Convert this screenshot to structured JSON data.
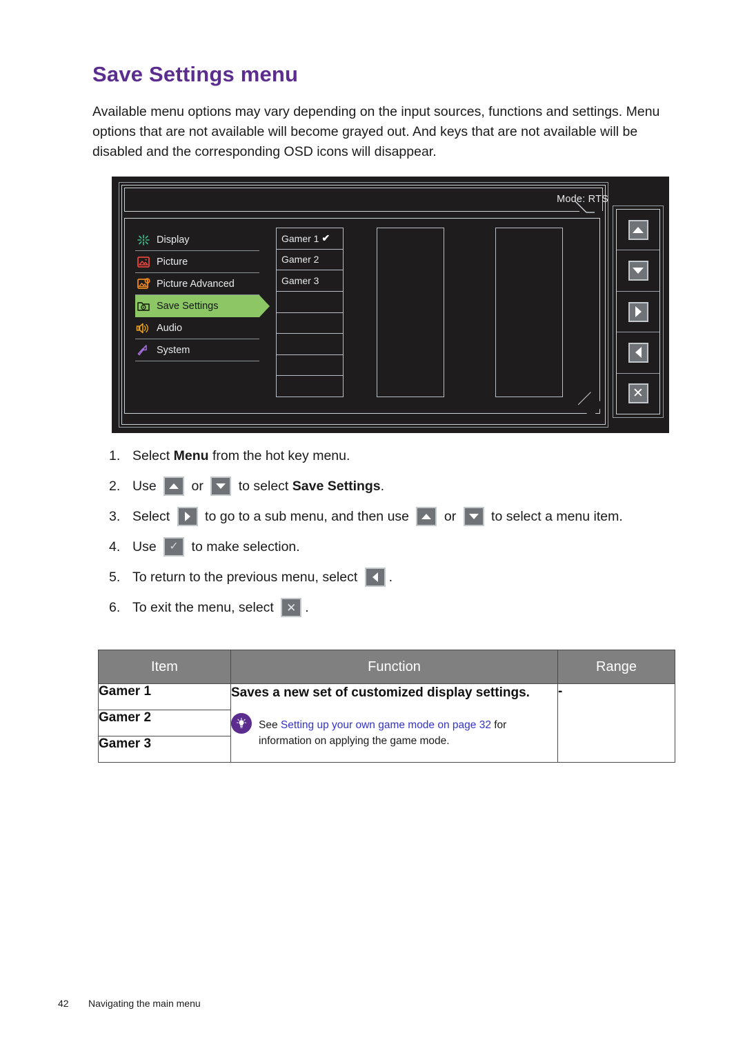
{
  "page": {
    "title": "Save Settings menu",
    "title_color": "#5b2d8e",
    "intro": "Available menu options may vary depending on the input sources, functions and settings. Menu options that are not available will become grayed out. And keys that are not available will be disabled and the corresponding OSD icons will disappear."
  },
  "osd": {
    "mode_label": "Mode: RTS",
    "menu_items": [
      {
        "label": "Display",
        "icon": "display-icon",
        "icon_color": "#3fbf8f",
        "selected": false
      },
      {
        "label": "Picture",
        "icon": "picture-icon",
        "icon_color": "#e8443c",
        "selected": false
      },
      {
        "label": "Picture Advanced",
        "icon": "picture-advanced-icon",
        "icon_color": "#f08a20",
        "selected": false
      },
      {
        "label": "Save Settings",
        "icon": "save-settings-icon",
        "icon_color": "#1d2b12",
        "selected": true
      },
      {
        "label": "Audio",
        "icon": "audio-icon",
        "icon_color": "#e8a01c",
        "selected": false
      },
      {
        "label": "System",
        "icon": "system-icon",
        "icon_color": "#a06fd8",
        "selected": false
      }
    ],
    "highlight_color": "#8cc665",
    "options": [
      {
        "label": "Gamer 1",
        "checked": true,
        "check_glyph": "✔"
      },
      {
        "label": "Gamer 2",
        "checked": false,
        "check_glyph": ""
      },
      {
        "label": "Gamer 3",
        "checked": false,
        "check_glyph": ""
      },
      {
        "label": "",
        "checked": false,
        "check_glyph": ""
      },
      {
        "label": "",
        "checked": false,
        "check_glyph": ""
      },
      {
        "label": "",
        "checked": false,
        "check_glyph": ""
      },
      {
        "label": "",
        "checked": false,
        "check_glyph": ""
      },
      {
        "label": "",
        "checked": false,
        "check_glyph": ""
      }
    ],
    "keys": [
      {
        "name": "up-key",
        "glyph": "▲"
      },
      {
        "name": "down-key",
        "glyph": "▼"
      },
      {
        "name": "right-key",
        "glyph": "▶"
      },
      {
        "name": "left-key",
        "glyph": "◀"
      },
      {
        "name": "exit-key",
        "glyph": "✕"
      }
    ]
  },
  "steps": [
    {
      "num": "1.",
      "parts": [
        {
          "t": "text",
          "v": "Select "
        },
        {
          "t": "bold",
          "v": "Menu"
        },
        {
          "t": "text",
          "v": " from the hot key menu."
        }
      ]
    },
    {
      "num": "2.",
      "parts": [
        {
          "t": "text",
          "v": "Use "
        },
        {
          "t": "key",
          "v": "up"
        },
        {
          "t": "text",
          "v": " or "
        },
        {
          "t": "key",
          "v": "down"
        },
        {
          "t": "text",
          "v": " to select "
        },
        {
          "t": "bold",
          "v": "Save Settings"
        },
        {
          "t": "text",
          "v": "."
        }
      ]
    },
    {
      "num": "3.",
      "parts": [
        {
          "t": "text",
          "v": "Select "
        },
        {
          "t": "key",
          "v": "right"
        },
        {
          "t": "text",
          "v": " to go to a sub menu, and then use "
        },
        {
          "t": "key",
          "v": "up"
        },
        {
          "t": "text",
          "v": " or "
        },
        {
          "t": "key",
          "v": "down"
        },
        {
          "t": "text",
          "v": " to select a menu item."
        }
      ]
    },
    {
      "num": "4.",
      "parts": [
        {
          "t": "text",
          "v": "Use "
        },
        {
          "t": "key",
          "v": "check"
        },
        {
          "t": "text",
          "v": " to make selection."
        }
      ]
    },
    {
      "num": "5.",
      "parts": [
        {
          "t": "text",
          "v": "To return to the previous menu, select "
        },
        {
          "t": "key",
          "v": "left"
        },
        {
          "t": "text",
          "v": "."
        }
      ]
    },
    {
      "num": "6.",
      "parts": [
        {
          "t": "text",
          "v": "To exit the menu, select "
        },
        {
          "t": "key",
          "v": "x"
        },
        {
          "t": "text",
          "v": "."
        }
      ]
    }
  ],
  "table": {
    "headers": {
      "item": "Item",
      "function": "Function",
      "range": "Range"
    },
    "items": [
      "Gamer 1",
      "Gamer 2",
      "Gamer 3"
    ],
    "function_lead": "Saves a new set of customized display settings.",
    "note": {
      "icon": "tip-bulb-icon",
      "before": "See ",
      "link": "Setting up your own game mode on page 32",
      "link_color": "#3333cc",
      "after": " for information on applying the game mode."
    },
    "range_value": "-"
  },
  "footer": {
    "page_number": "42",
    "section": "Navigating the main menu"
  }
}
